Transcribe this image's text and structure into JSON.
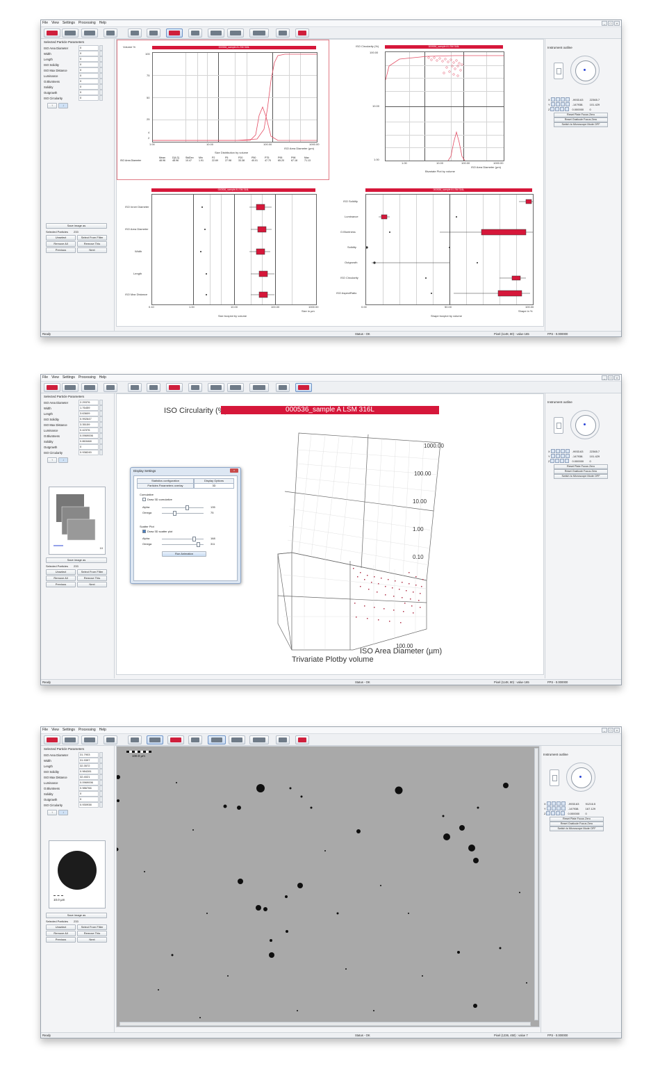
{
  "menu": [
    "File",
    "View",
    "Settings",
    "Processing",
    "Help"
  ],
  "status": {
    "ready": "Ready",
    "ok": "Status - OK",
    "fps": "FPS - 0.000000"
  },
  "left_panel": {
    "title": "Selected Particle Parameters",
    "param_labels": [
      "ISO Area Diameter",
      "Width",
      "Length",
      "ISO Solidity",
      "ISO Max Distance",
      "Luminance",
      "O.Bluntness",
      "Solidity",
      "Outgrowth",
      "ISO Circularity"
    ],
    "save_image": "Save image as",
    "selected_particles_label": "Selected Particles",
    "selected_particles_value": "233",
    "unselect": "Unselect",
    "select_from_filter": "Select From Filter",
    "remove_all": "Remove All",
    "remove_this": "Remove This",
    "previous": "Previous",
    "next": "Next"
  },
  "right_panel": {
    "title": "Instrument outline",
    "axes": [
      "X",
      "Y",
      "Z"
    ],
    "reset_plate": "Reset Plate Focus Zero",
    "reset_graticule": "Reset Graticule Focus Zero",
    "switch_mode": "Switch to Microscope Mode OFF"
  },
  "screens": [
    {
      "params": [
        "0",
        "0",
        "0",
        "0",
        "0",
        "0",
        "0",
        "0",
        "0",
        "0"
      ],
      "coords": {
        "x": [
          "-9933.63",
          "22365.7"
        ],
        "y": [
          "-147938.",
          "101.429"
        ],
        "z": [
          "0.000000",
          "0"
        ]
      },
      "pixel": "Pixel (1148, 80) : value 165"
    },
    {
      "params": [
        "2.29376",
        "1.76459",
        "3.63609",
        "0.992647",
        "3.35159",
        "0.42376",
        "0.0969006",
        "0.863468",
        "0",
        "0.938245"
      ],
      "coords": {
        "x": [
          "-9933.63",
          "22365.7"
        ],
        "y": [
          "-147938.",
          "101.429"
        ],
        "z": [
          "0.000000",
          "0"
        ]
      },
      "pixel": "Pixel (1148, 80) : value 165",
      "particle_scale": "10"
    },
    {
      "params": [
        "31.7903",
        "31.9397",
        "32.3572",
        "0.984281",
        "32.4021",
        "0.0969006",
        "0.986766",
        "0",
        "0",
        "0.930938"
      ],
      "coords": {
        "x": [
          "-9933.63",
          "91216.5"
        ],
        "y": [
          "-147938.",
          "167.129"
        ],
        "z": [
          "0.000000",
          "0"
        ]
      },
      "pixel": "Pixel (1236, 450) : value 7",
      "particle_scale": "10.0 µm",
      "image_scale": "100.0 µm"
    }
  ],
  "sample_title": "000536_sample A LSM 316L",
  "plot1": {
    "ylabel": "Volume %",
    "yticks": [
      "100",
      "75",
      "50",
      "25",
      "4",
      "2"
    ],
    "xticks": [
      "1.00",
      "10.00",
      "100.00",
      "1000.00"
    ],
    "xlabel": "ISO Area Diameter (µm)",
    "caption": "Size Distribution by volume",
    "stats_headers": [
      "Mean",
      "D[4,3]",
      "StdDev",
      "Min",
      "P2",
      "P5",
      "P20",
      "P50",
      "P75",
      "P95",
      "P98",
      "Max"
    ],
    "stats_row_label": "ISO Area Diameter",
    "stats_values": [
      "48.96",
      "48.96",
      "10.47",
      "1.91",
      "22.69",
      "27.98",
      "33.38",
      "40.01",
      "47.70",
      "65.20",
      "67.18",
      "71.13"
    ]
  },
  "plot2": {
    "ylabel": "ISO Circularity (%)",
    "yticks": [
      "100.00",
      "10.00",
      "1.00"
    ],
    "xticks": [
      "1.00",
      "10.00",
      "100.00",
      "1000.00"
    ],
    "xlabel": "ISO Area Diameter (µm)",
    "caption": "Bivariate Plot by volume"
  },
  "plot3": {
    "categories": [
      "ISO Inner Diameter",
      "ISO Area Diameter",
      "Width",
      "Length",
      "ISO Max Distance"
    ],
    "xticks": [
      "0.10",
      "1.00",
      "10.00",
      "100.00",
      "1000.00"
    ],
    "xlabel": "Size in µm",
    "caption": "Size boxplot by volume"
  },
  "plot4": {
    "categories": [
      "ISO Solidity",
      "Luminance",
      "O.Bluntness",
      "Solidity",
      "Outgrowth",
      "ISO Circularity",
      "ISO AspectRatio"
    ],
    "xticks": [
      "0.00",
      "50.00",
      "100.00"
    ],
    "xlabel": "Shape in %",
    "caption": "Shape boxplot by volume"
  },
  "plot3d": {
    "zlabel": "ISO Circularity (%)",
    "zticks": [
      "1000.00",
      "100.00",
      "10.00",
      "1.00",
      "0.10"
    ],
    "xlabel": "ISO Area Diameter (µm)",
    "xtick": "100.00",
    "caption": "Trivariate Plotby volume"
  },
  "dialog": {
    "title": "Display Settings",
    "tabs": [
      "Statistics configuration",
      "Display Options",
      "Particles Parameters overlay",
      "3D"
    ],
    "cumulative": "Cumulative",
    "draw_cumulative": "Draw 3D cumulative",
    "alpha": "Alpha",
    "omega": "Omega",
    "cum_alpha": "135",
    "cum_omega": "75",
    "scatter": "Scatter Plot",
    "draw_scatter": "Draw 3D scatter plot",
    "sc_alpha": "168",
    "sc_omega": "311",
    "run": "Run Animation"
  },
  "colors": {
    "accent": "#d6173a",
    "window": "#f3f4f6"
  }
}
